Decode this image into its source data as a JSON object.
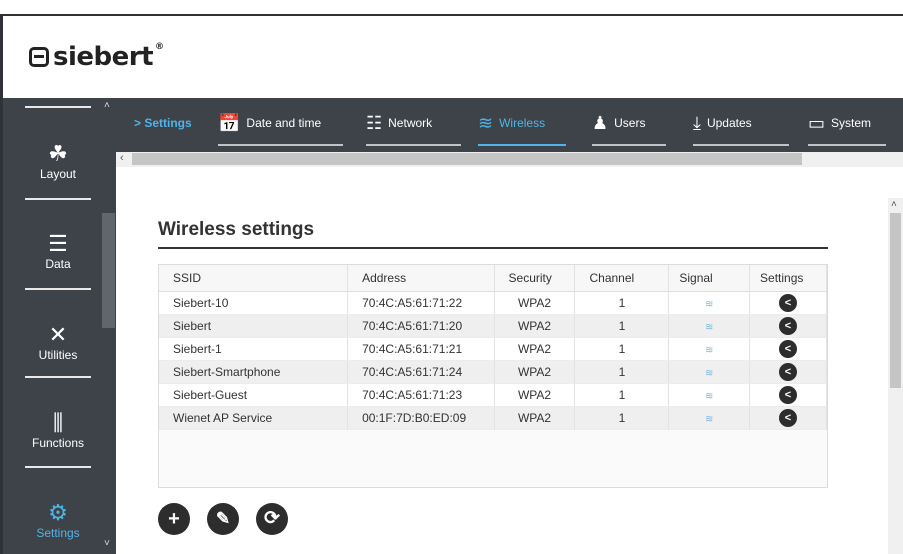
{
  "brand": {
    "name": "siebert",
    "reg": "®"
  },
  "sidebar": {
    "items": [
      {
        "label": "Layout",
        "icon": "layout-icon",
        "glyph": "⚙"
      },
      {
        "label": "Data",
        "icon": "database-icon",
        "glyph": "☰"
      },
      {
        "label": "Utilities",
        "icon": "tools-icon",
        "glyph": "✕"
      },
      {
        "label": "Functions",
        "icon": "sliders-icon",
        "glyph": "⫼"
      },
      {
        "label": "Settings",
        "icon": "settings-gears-icon",
        "glyph": "⚙"
      }
    ]
  },
  "breadcrumb": "> Settings",
  "tabs": [
    {
      "label": "Date and time",
      "icon": "calendar-clock-icon",
      "glyph": "📅"
    },
    {
      "label": "Network",
      "icon": "network-icon",
      "glyph": "⊤"
    },
    {
      "label": "Wireless",
      "icon": "wifi-icon",
      "glyph": "≋"
    },
    {
      "label": "Users",
      "icon": "users-icon",
      "glyph": "👥"
    },
    {
      "label": "Updates",
      "icon": "download-icon",
      "glyph": "⤓"
    },
    {
      "label": "System",
      "icon": "monitor-icon",
      "glyph": "▭"
    }
  ],
  "main": {
    "title": "Wireless settings",
    "columns": [
      "SSID",
      "Address",
      "Security",
      "Channel",
      "Signal",
      "Settings"
    ],
    "rows": [
      {
        "ssid": "Siebert-10",
        "address": "70:4C:A5:61:71:22",
        "security": "WPA2",
        "channel": "1"
      },
      {
        "ssid": "Siebert",
        "address": "70:4C:A5:61:71:20",
        "security": "WPA2",
        "channel": "1"
      },
      {
        "ssid": "Siebert-1",
        "address": "70:4C:A5:61:71:21",
        "security": "WPA2",
        "channel": "1"
      },
      {
        "ssid": "Siebert-Smartphone",
        "address": "70:4C:A5:61:71:24",
        "security": "WPA2",
        "channel": "1"
      },
      {
        "ssid": "Siebert-Guest",
        "address": "70:4C:A5:61:71:23",
        "security": "WPA2",
        "channel": "1"
      },
      {
        "ssid": "Wienet AP Service",
        "address": "00:1F:7D:B0:ED:09",
        "security": "WPA2",
        "channel": "1"
      }
    ],
    "actions": [
      {
        "name": "add-button",
        "icon": "plus-icon",
        "glyph": "+"
      },
      {
        "name": "edit-button",
        "icon": "edit-icon",
        "glyph": "✎"
      },
      {
        "name": "refresh-button",
        "icon": "refresh-icon",
        "glyph": "⟳"
      }
    ]
  },
  "colors": {
    "accent": "#4fb4e8",
    "sidebar": "#3d4349",
    "button": "#2d2d2d"
  }
}
